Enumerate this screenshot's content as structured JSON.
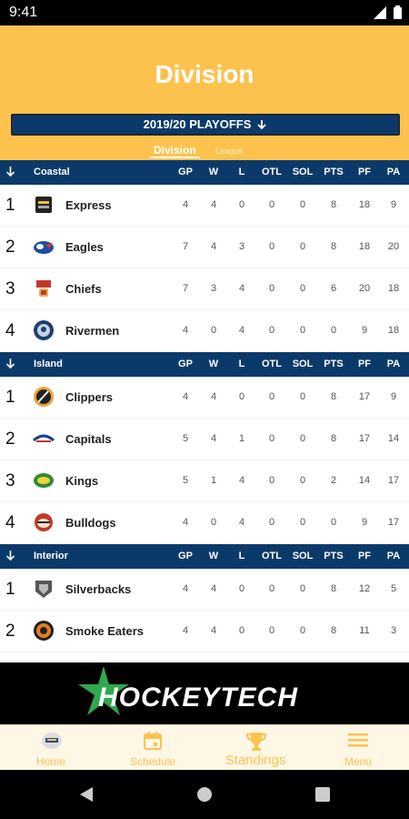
{
  "status": {
    "time": "9:41"
  },
  "header": {
    "title": "Division",
    "season": "2019/20 PLAYOFFS",
    "tabs": {
      "division": "Division",
      "league": "League"
    }
  },
  "columns": [
    "GP",
    "W",
    "L",
    "OTL",
    "SOL",
    "PTS",
    "PF",
    "PA"
  ],
  "groups": [
    {
      "name": "Coastal",
      "rows": [
        {
          "rank": "1",
          "team": "Express",
          "logo_icon": "express-logo-icon",
          "stats": [
            "4",
            "4",
            "0",
            "0",
            "0",
            "8",
            "18",
            "9"
          ]
        },
        {
          "rank": "2",
          "team": "Eagles",
          "logo_icon": "eagles-logo-icon",
          "stats": [
            "7",
            "4",
            "3",
            "0",
            "0",
            "8",
            "18",
            "20"
          ]
        },
        {
          "rank": "3",
          "team": "Chiefs",
          "logo_icon": "chiefs-logo-icon",
          "stats": [
            "7",
            "3",
            "4",
            "0",
            "0",
            "6",
            "20",
            "18"
          ]
        },
        {
          "rank": "4",
          "team": "Rivermen",
          "logo_icon": "rivermen-logo-icon",
          "stats": [
            "4",
            "0",
            "4",
            "0",
            "0",
            "0",
            "9",
            "18"
          ]
        }
      ]
    },
    {
      "name": "Island",
      "rows": [
        {
          "rank": "1",
          "team": "Clippers",
          "logo_icon": "clippers-logo-icon",
          "stats": [
            "4",
            "4",
            "0",
            "0",
            "0",
            "8",
            "17",
            "9"
          ]
        },
        {
          "rank": "2",
          "team": "Capitals",
          "logo_icon": "capitals-logo-icon",
          "stats": [
            "5",
            "4",
            "1",
            "0",
            "0",
            "8",
            "17",
            "14"
          ]
        },
        {
          "rank": "3",
          "team": "Kings",
          "logo_icon": "kings-logo-icon",
          "stats": [
            "5",
            "1",
            "4",
            "0",
            "0",
            "2",
            "14",
            "17"
          ]
        },
        {
          "rank": "4",
          "team": "Bulldogs",
          "logo_icon": "bulldogs-logo-icon",
          "stats": [
            "4",
            "0",
            "4",
            "0",
            "0",
            "0",
            "9",
            "17"
          ]
        }
      ]
    },
    {
      "name": "Interior",
      "rows": [
        {
          "rank": "1",
          "team": "Silverbacks",
          "logo_icon": "silverbacks-logo-icon",
          "stats": [
            "4",
            "4",
            "0",
            "0",
            "0",
            "8",
            "12",
            "5"
          ]
        },
        {
          "rank": "2",
          "team": "Smoke Eaters",
          "logo_icon": "smoke-eaters-logo-icon",
          "stats": [
            "4",
            "4",
            "0",
            "0",
            "0",
            "8",
            "11",
            "3"
          ]
        }
      ]
    }
  ],
  "banner": {
    "text": "HOCKEYTECH"
  },
  "bottom_nav": [
    {
      "label": "Home",
      "icon": "home-logo-icon"
    },
    {
      "label": "Schedule",
      "icon": "calendar-icon"
    },
    {
      "label": "Standings",
      "icon": "trophy-icon"
    },
    {
      "label": "Menu",
      "icon": "hamburger-menu-icon"
    }
  ],
  "colors": {
    "accent": "#fdc24e",
    "navy": "#0b3a6a",
    "banner_green": "#2fa84f"
  }
}
